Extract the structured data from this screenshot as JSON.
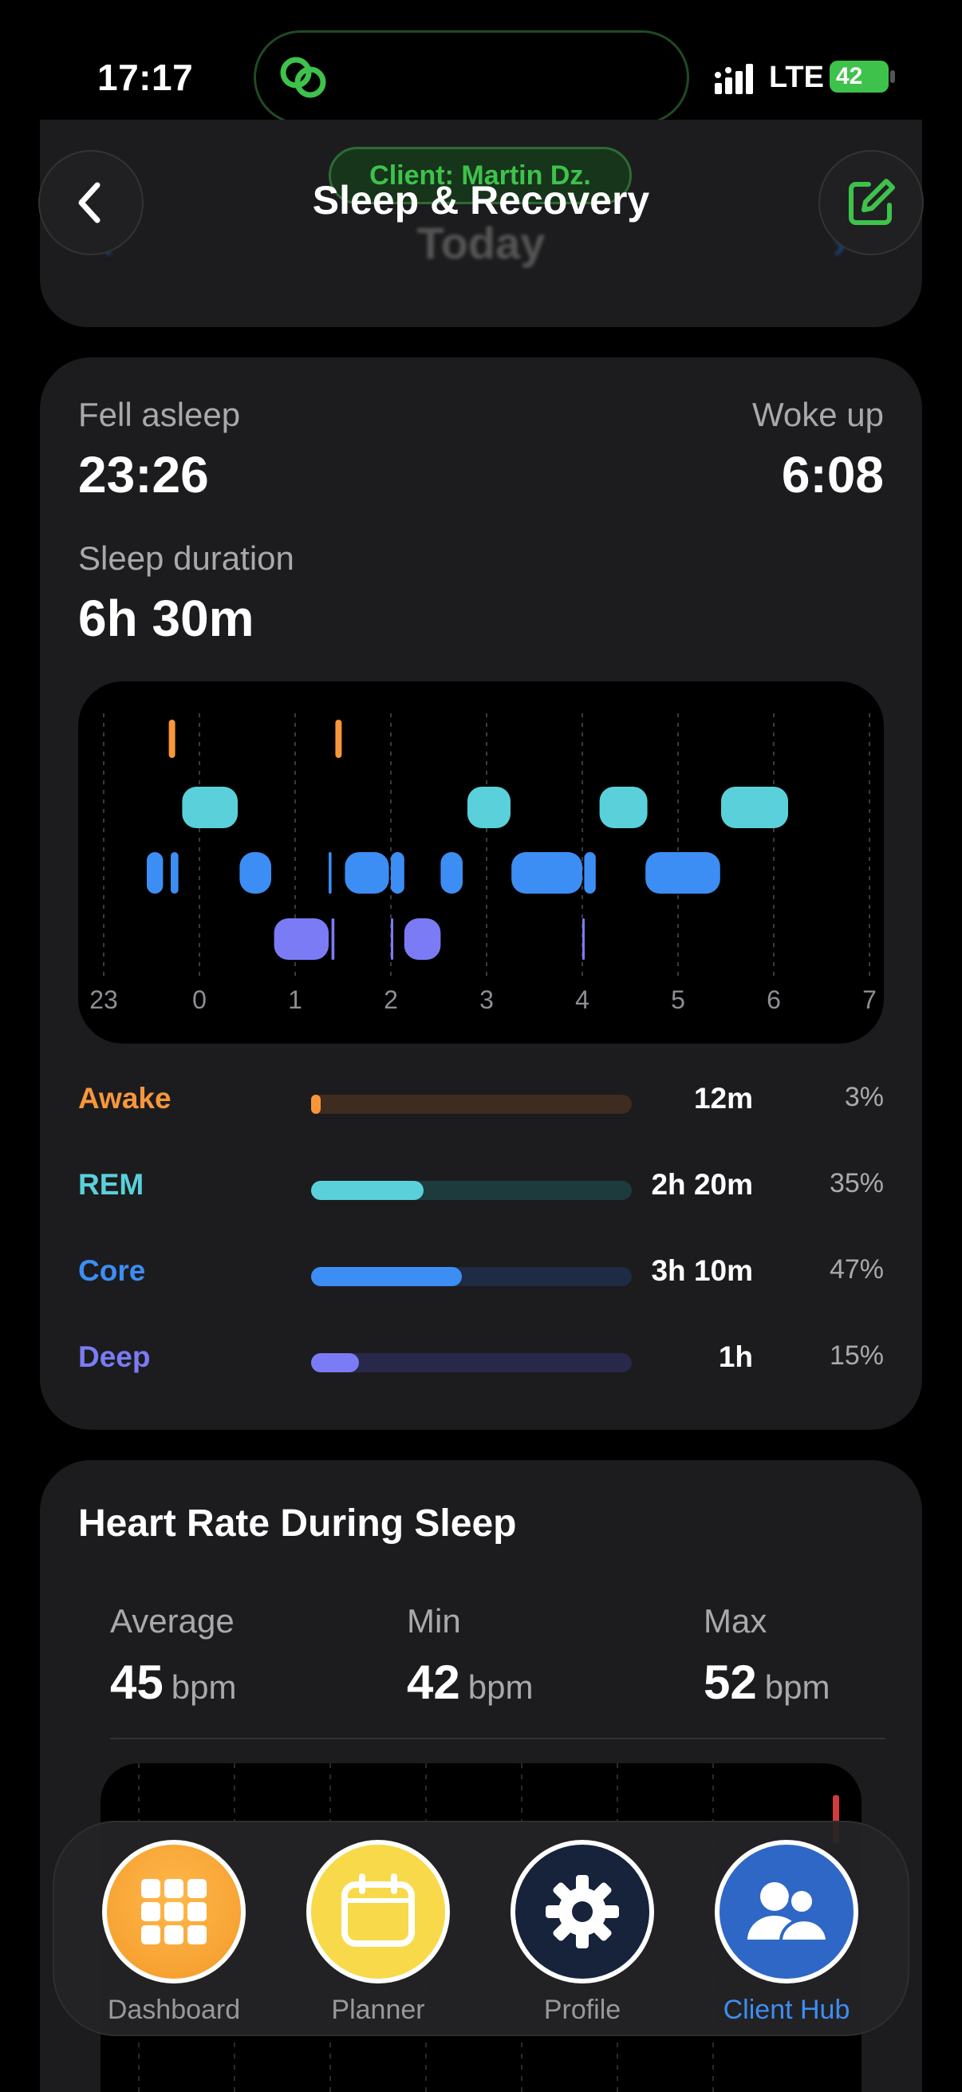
{
  "status_bar": {
    "time": "17:17",
    "network": "LTE",
    "battery": "42"
  },
  "header": {
    "client_label": "Client: Martin Dz.",
    "title": "Sleep & Recovery",
    "date_label": "Today",
    "back_icon": "chevron-left-icon",
    "edit_icon": "edit-square-icon"
  },
  "sleep": {
    "fell_asleep_label": "Fell asleep",
    "fell_asleep_value": "23:26",
    "woke_up_label": "Woke up",
    "woke_up_value": "6:08",
    "duration_label": "Sleep duration",
    "duration_value": "6h 30m",
    "hypnogram": {
      "hour_ticks": [
        "23",
        "0",
        "1",
        "2",
        "3",
        "4",
        "5",
        "6",
        "7"
      ],
      "segments": [
        {
          "stage": "awake",
          "start": 23.68,
          "end": 23.7
        },
        {
          "stage": "awake",
          "start": 1.42,
          "end": 1.48
        },
        {
          "stage": "rem",
          "start": 23.82,
          "end": 0.4
        },
        {
          "stage": "rem",
          "start": 2.8,
          "end": 3.25
        },
        {
          "stage": "rem",
          "start": 4.18,
          "end": 4.68
        },
        {
          "stage": "rem",
          "start": 5.45,
          "end": 6.15
        },
        {
          "stage": "core",
          "start": 23.45,
          "end": 23.62
        },
        {
          "stage": "core",
          "start": 23.7,
          "end": 23.78
        },
        {
          "stage": "core",
          "start": 0.42,
          "end": 0.75
        },
        {
          "stage": "core",
          "start": 1.35,
          "end": 1.38
        },
        {
          "stage": "core",
          "start": 1.52,
          "end": 1.98
        },
        {
          "stage": "core",
          "start": 2.0,
          "end": 2.14
        },
        {
          "stage": "core",
          "start": 2.52,
          "end": 2.75
        },
        {
          "stage": "core",
          "start": 3.26,
          "end": 4.0
        },
        {
          "stage": "core",
          "start": 4.02,
          "end": 4.14
        },
        {
          "stage": "core",
          "start": 4.66,
          "end": 5.44
        },
        {
          "stage": "deep",
          "start": 0.78,
          "end": 1.35
        },
        {
          "stage": "deep",
          "start": 1.38,
          "end": 1.41
        },
        {
          "stage": "deep",
          "start": 2.0,
          "end": 2.02
        },
        {
          "stage": "deep",
          "start": 2.14,
          "end": 2.52
        },
        {
          "stage": "deep",
          "start": 4.0,
          "end": 4.02
        }
      ]
    },
    "stages": [
      {
        "name": "Awake",
        "duration": "12m",
        "percent": "3%",
        "fraction": 0.03,
        "color": "#f7963a",
        "track": "#3d2c1f"
      },
      {
        "name": "REM",
        "duration": "2h 20m",
        "percent": "35%",
        "fraction": 0.35,
        "color": "#5ad1da",
        "track": "#1d3a3d"
      },
      {
        "name": "Core",
        "duration": "3h 10m",
        "percent": "47%",
        "fraction": 0.47,
        "color": "#3d8ef4",
        "track": "#1d2c42"
      },
      {
        "name": "Deep",
        "duration": "1h",
        "percent": "15%",
        "fraction": 0.15,
        "color": "#7b7bf5",
        "track": "#28284a"
      }
    ]
  },
  "heart_rate": {
    "title": "Heart Rate During Sleep",
    "average_label": "Average",
    "average_value": "45",
    "average_unit": "bpm",
    "min_label": "Min",
    "min_value": "42",
    "min_unit": "bpm",
    "max_label": "Max",
    "max_value": "52",
    "max_unit": "bpm"
  },
  "tabs": [
    {
      "label": "Dashboard",
      "icon": "grid-icon",
      "active": false
    },
    {
      "label": "Planner",
      "icon": "calendar-icon",
      "active": false
    },
    {
      "label": "Profile",
      "icon": "gear-icon",
      "active": false
    },
    {
      "label": "Client Hub",
      "icon": "users-icon",
      "active": true
    }
  ],
  "colors": {
    "accent_green": "#3fc24c",
    "active_tab": "#3d8ef4"
  }
}
